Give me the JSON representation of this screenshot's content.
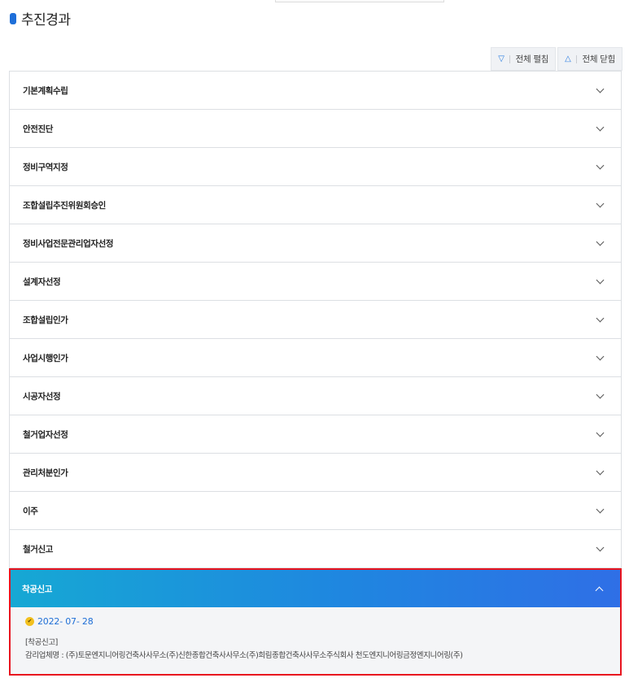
{
  "section": {
    "title": "추진경과"
  },
  "toolbar": {
    "expand_label": "전체 펼침",
    "collapse_label": "전체 닫힘"
  },
  "accordion": {
    "items": [
      {
        "label": "기본계획수립"
      },
      {
        "label": "안전진단"
      },
      {
        "label": "정비구역지정"
      },
      {
        "label": "조합설립추진위원회승인"
      },
      {
        "label": "정비사업전문관리업자선정"
      },
      {
        "label": "설계자선정"
      },
      {
        "label": "조합설립인가"
      },
      {
        "label": "사업시행인가"
      },
      {
        "label": "시공자선정"
      },
      {
        "label": "철거업자선정"
      },
      {
        "label": "관리처분인가"
      },
      {
        "label": "이주"
      },
      {
        "label": "철거신고"
      }
    ],
    "active": {
      "label": "착공신고",
      "date": "2022- 07- 28",
      "line1": "[착공신고]",
      "line2": "감리업체명 : (주)토문엔지니어링건축사사무소(주)신한종합건축사사무소(주)희림종합건축사사무소주식회사 천도엔지니어링금정엔지니어링(주)"
    }
  },
  "colors": {
    "accent": "#1e6fd9",
    "active_gradient_start": "#16a8d4",
    "active_gradient_end": "#2f6fe6",
    "highlight_border": "#e8141f",
    "date_color": "#1f6fd6",
    "check_badge": "#f2c01e"
  },
  "icons": {
    "expand": "chevron-down-outline-icon",
    "collapse": "chevron-up-outline-icon",
    "item": "chevron-down-icon",
    "active_item": "chevron-up-icon",
    "date": "check-circle-icon"
  }
}
